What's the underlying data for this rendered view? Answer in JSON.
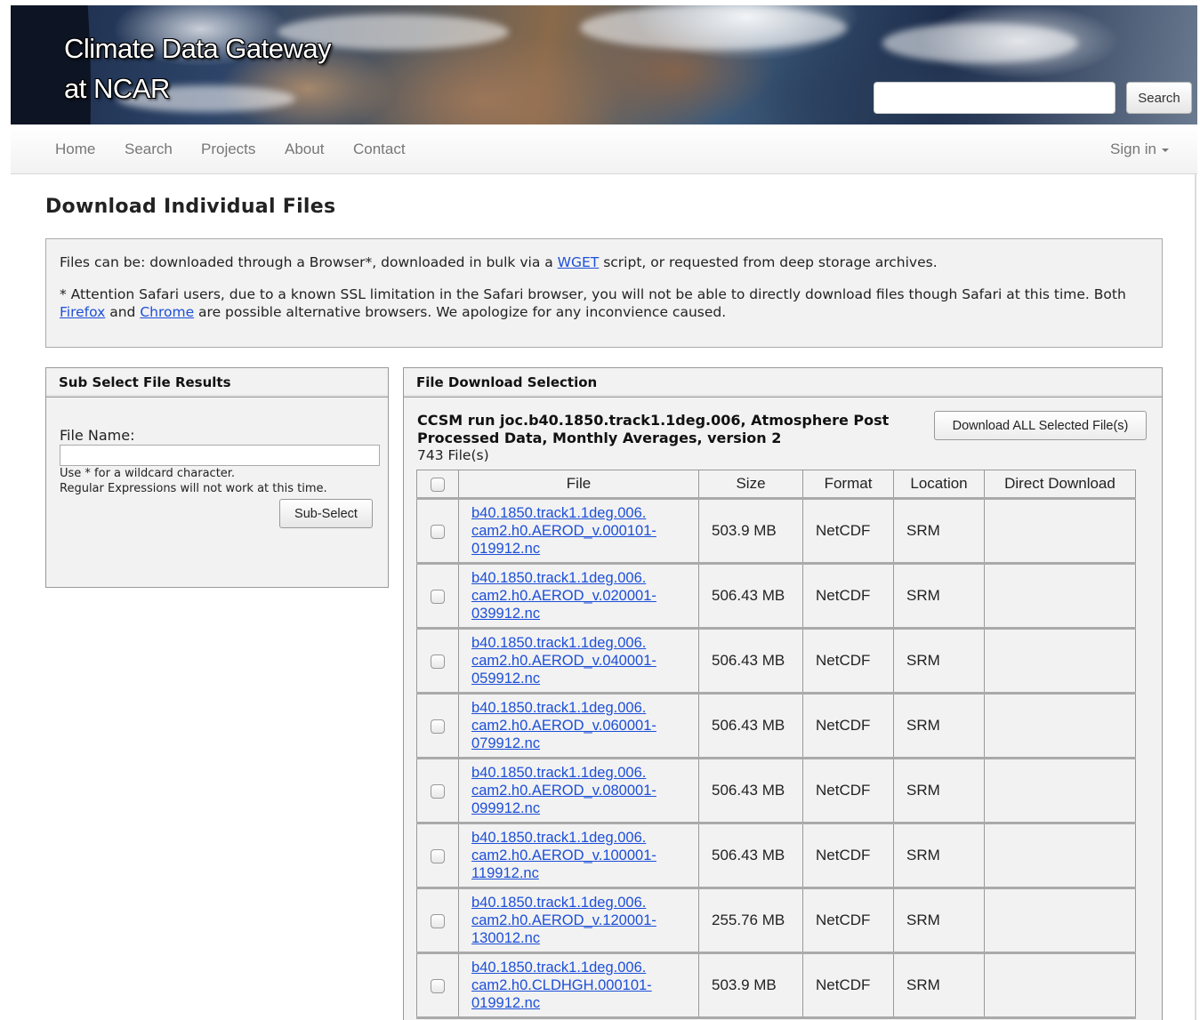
{
  "header": {
    "title_line1": "Climate Data Gateway",
    "title_line2": "at NCAR",
    "search_value": "",
    "search_button": "Search"
  },
  "nav": {
    "items": [
      "Home",
      "Search",
      "Projects",
      "About",
      "Contact"
    ],
    "sign_in": "Sign in"
  },
  "page_title": "Download Individual Files",
  "notice": {
    "line1_prefix": "Files can be: downloaded through a Browser*, downloaded in bulk via a ",
    "line1_link": "WGET",
    "line1_suffix": " script, or requested from deep storage archives.",
    "line2_prefix": "* Attention Safari users, due to a known SSL limitation in the Safari browser, you will not be able to directly download files though Safari at this time. Both ",
    "firefox_link": "Firefox",
    "and": " and ",
    "chrome_link": "Chrome",
    "line2_suffix": " are possible alternative browsers. We apologize for any inconvience caused."
  },
  "sub_select": {
    "heading": "Sub Select File Results",
    "file_name_label": "File Name:",
    "file_name_value": "",
    "hint_line1": "Use * for a wildcard character.",
    "hint_line2": "Regular Expressions will not work at this time.",
    "button": "Sub-Select"
  },
  "download": {
    "heading": "File Download Selection",
    "dataset_title": "CCSM run joc.b40.1850.track1.1deg.006, Atmosphere Post Processed Data, Monthly Averages, version 2",
    "file_count": "743 File(s)",
    "download_all_button": "Download ALL Selected File(s)",
    "columns": {
      "file": "File",
      "size": "Size",
      "format": "Format",
      "location": "Location",
      "direct": "Direct Download"
    },
    "rows": [
      {
        "file": [
          "b40.1850.track1.1deg.006.",
          "cam2.h0.AEROD_v.000101-",
          "019912.nc"
        ],
        "size": "503.9 MB",
        "format": "NetCDF",
        "location": "SRM"
      },
      {
        "file": [
          "b40.1850.track1.1deg.006.",
          "cam2.h0.AEROD_v.020001-",
          "039912.nc"
        ],
        "size": "506.43 MB",
        "format": "NetCDF",
        "location": "SRM"
      },
      {
        "file": [
          "b40.1850.track1.1deg.006.",
          "cam2.h0.AEROD_v.040001-",
          "059912.nc"
        ],
        "size": "506.43 MB",
        "format": "NetCDF",
        "location": "SRM"
      },
      {
        "file": [
          "b40.1850.track1.1deg.006.",
          "cam2.h0.AEROD_v.060001-",
          "079912.nc"
        ],
        "size": "506.43 MB",
        "format": "NetCDF",
        "location": "SRM"
      },
      {
        "file": [
          "b40.1850.track1.1deg.006.",
          "cam2.h0.AEROD_v.080001-",
          "099912.nc"
        ],
        "size": "506.43 MB",
        "format": "NetCDF",
        "location": "SRM"
      },
      {
        "file": [
          "b40.1850.track1.1deg.006.",
          "cam2.h0.AEROD_v.100001-",
          "119912.nc"
        ],
        "size": "506.43 MB",
        "format": "NetCDF",
        "location": "SRM"
      },
      {
        "file": [
          "b40.1850.track1.1deg.006.",
          "cam2.h0.AEROD_v.120001-",
          "130012.nc"
        ],
        "size": "255.76 MB",
        "format": "NetCDF",
        "location": "SRM"
      },
      {
        "file": [
          "b40.1850.track1.1deg.006.",
          "cam2.h0.CLDHGH.000101-",
          "019912.nc"
        ],
        "size": "503.9 MB",
        "format": "NetCDF",
        "location": "SRM"
      }
    ]
  }
}
